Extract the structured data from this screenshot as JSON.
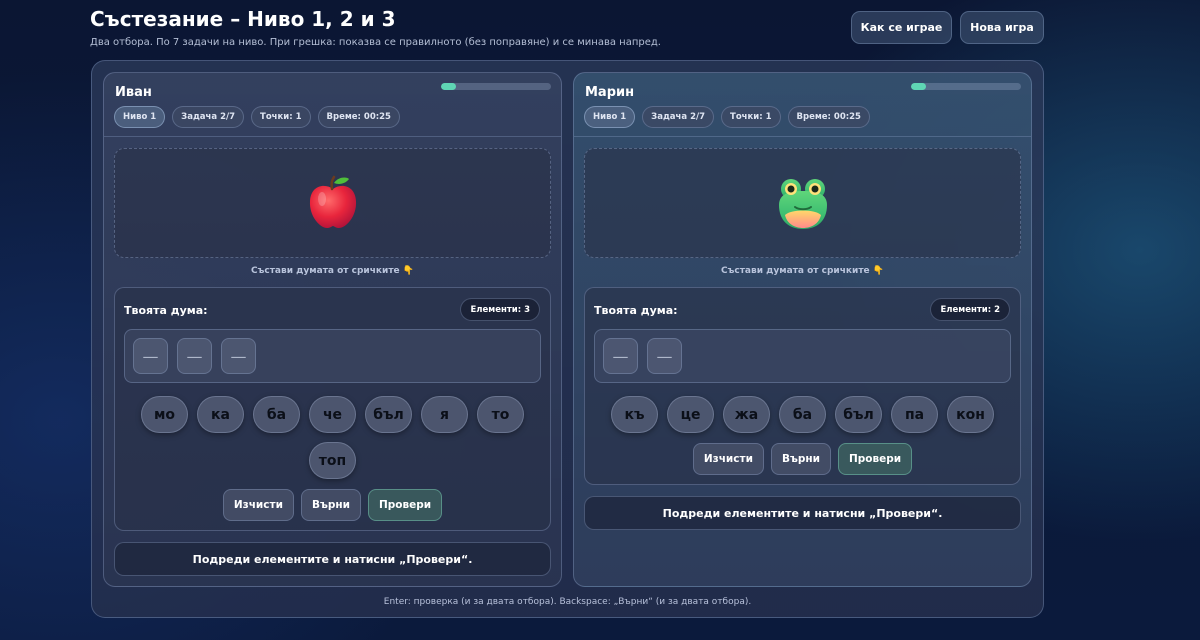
{
  "header": {
    "title": "Състезание – Ниво 1, 2 и 3",
    "subtitle": "Два отбора. По 7 задачи на ниво. При грешка: показва се правилното (без поправяне) и се минава напред.",
    "how_to_play_label": "Как се играе",
    "new_game_label": "Нова игра"
  },
  "teams": [
    {
      "name": "Иван",
      "progress": 0.14,
      "level": "Ниво 1",
      "task": "Задача 2/7",
      "points": "Точки: 1",
      "time": "Време: 00:25",
      "picture_icon": "apple-icon",
      "hint": "Състави думата от сричките 👇",
      "word_label": "Твоята дума:",
      "elements_count": "Елементи: 3",
      "slots": [
        "—",
        "—",
        "—"
      ],
      "tiles": [
        "мо",
        "ка",
        "ба",
        "че",
        "бъл",
        "я",
        "то",
        "топ"
      ],
      "clear_label": "Изчисти",
      "undo_label": "Върни",
      "check_label": "Провери",
      "status": "Подреди елементите и натисни „Провери“."
    },
    {
      "name": "Марин",
      "progress": 0.14,
      "level": "Ниво 1",
      "task": "Задача 2/7",
      "points": "Точки: 1",
      "time": "Време: 00:25",
      "picture_icon": "frog-icon",
      "hint": "Състави думата от сричките 👇",
      "word_label": "Твоята дума:",
      "elements_count": "Елементи: 2",
      "slots": [
        "—",
        "—"
      ],
      "tiles": [
        "къ",
        "це",
        "жа",
        "ба",
        "бъл",
        "па",
        "кон"
      ],
      "clear_label": "Изчисти",
      "undo_label": "Върни",
      "check_label": "Провери",
      "status": "Подреди елементите и натисни „Провери“."
    }
  ],
  "footer_hint": "Enter: проверка (и за двата отбора). Backspace: „Върни“ (и за двата отбора)."
}
